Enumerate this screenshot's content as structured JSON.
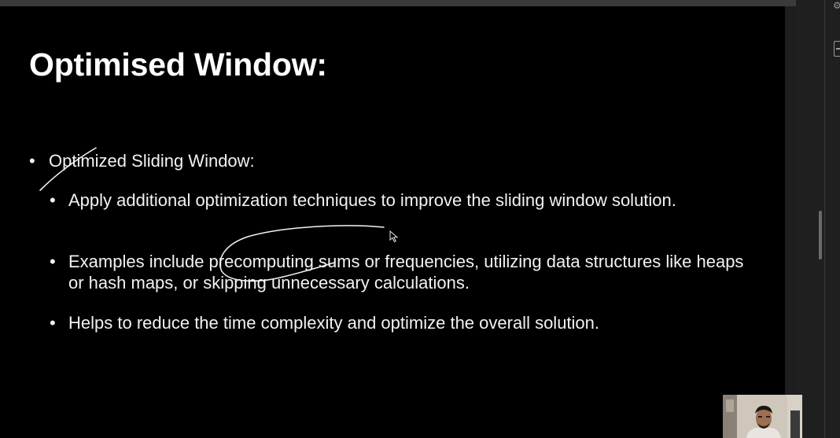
{
  "slide": {
    "title": "Optimised Window:",
    "bullets": [
      {
        "level": 1,
        "text": "Optimized Sliding Window:"
      },
      {
        "level": 2,
        "text": "Apply additional optimization techniques to improve the sliding window solution."
      },
      {
        "level": 2,
        "text": "Examples include precomputing sums or frequencies, utilizing data structures like heaps or hash maps, or skipping unnecessary calculations."
      },
      {
        "level": 2,
        "text": "Helps to reduce the time complexity and optimize the overall solution."
      }
    ],
    "bullet_symbol": "•"
  },
  "annotations": {
    "stroke_color": "#f5f5f5"
  },
  "side_panel": {
    "top_icon": "gear-icon",
    "box_icon": "panel-toggle-icon"
  },
  "colors": {
    "slide_background": "#000000",
    "text": "#f2f2f2",
    "chrome": "#1f1f1f"
  }
}
